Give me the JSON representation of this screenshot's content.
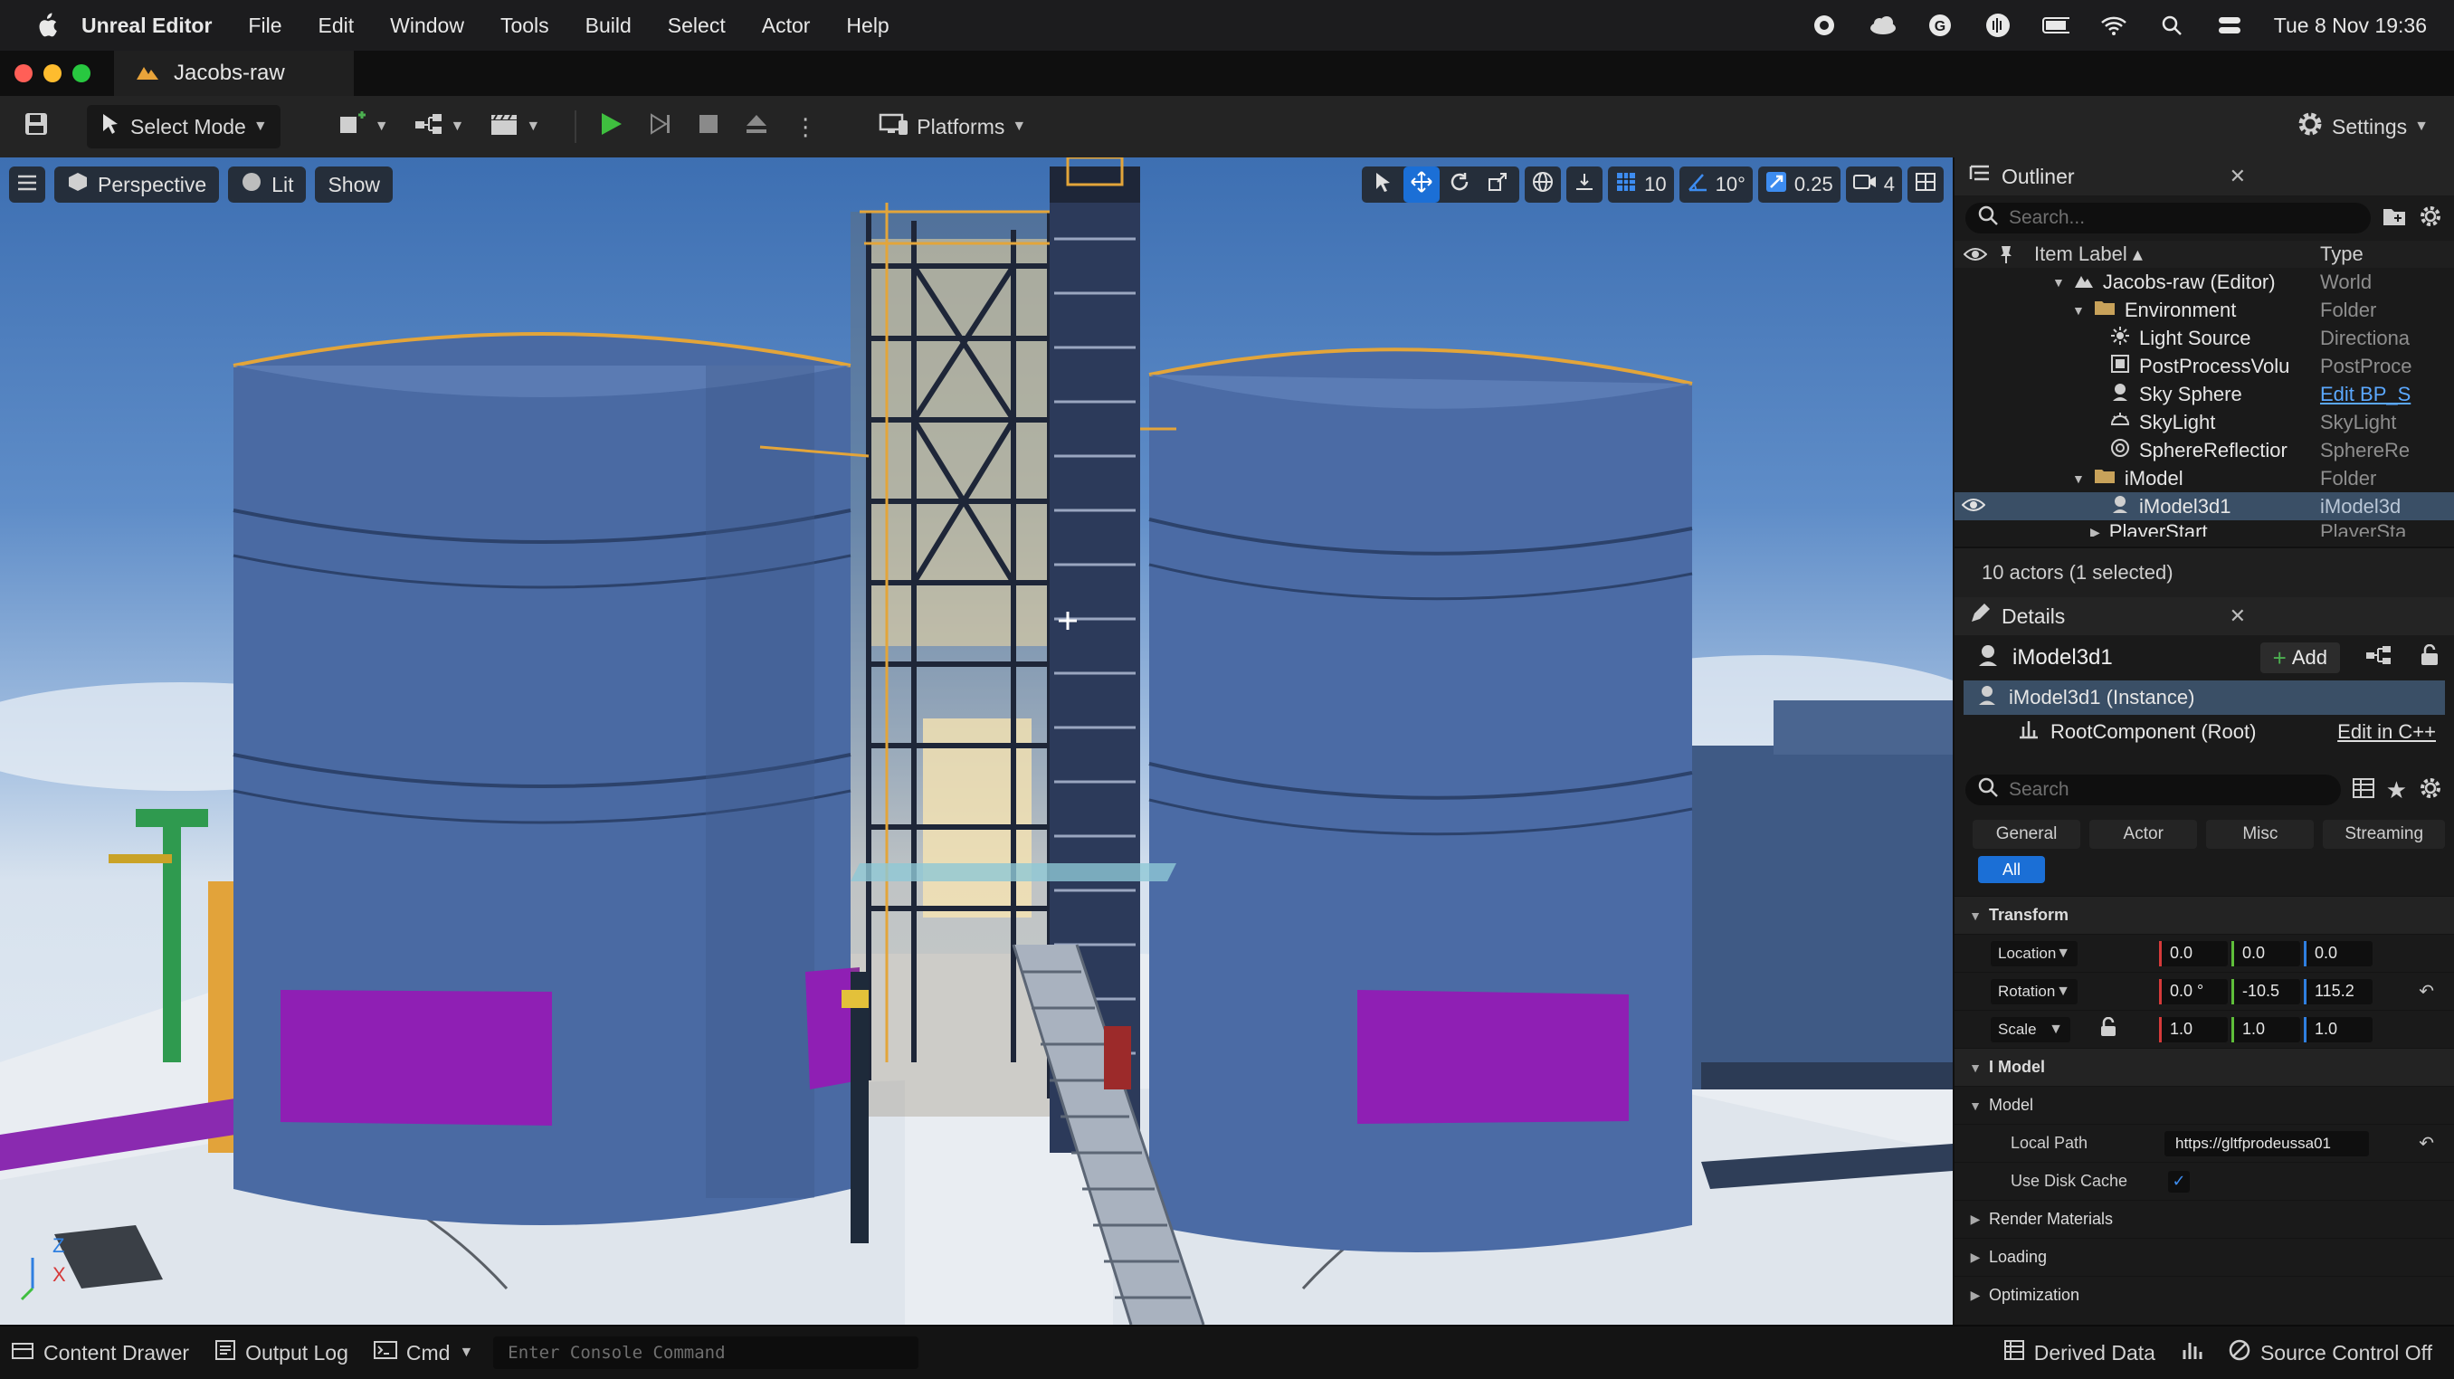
{
  "menubar": {
    "app_name": "Unreal Editor",
    "menus": [
      "File",
      "Edit",
      "Window",
      "Tools",
      "Build",
      "Select",
      "Actor",
      "Help"
    ],
    "clock": "Tue 8 Nov  19:36"
  },
  "window": {
    "tab_title": "Jacobs-raw"
  },
  "toolbar": {
    "select_mode": "Select Mode",
    "platforms": "Platforms",
    "settings": "Settings"
  },
  "viewport": {
    "perspective": "Perspective",
    "lit": "Lit",
    "show": "Show",
    "grid_snap": "10",
    "rotation_snap": "10°",
    "scale_snap": "0.25",
    "camera_speed": "4",
    "axis_z": "Z",
    "axis_x": "X"
  },
  "outliner": {
    "title": "Outliner",
    "search_placeholder": "Search...",
    "col_label": "Item Label ▴",
    "col_type": "Type",
    "rows": [
      {
        "label": "Jacobs-raw (Editor)",
        "type": "World"
      },
      {
        "label": "Environment",
        "type": "Folder"
      },
      {
        "label": "Light Source",
        "type": "Directiona"
      },
      {
        "label": "PostProcessVolu",
        "type": "PostProce"
      },
      {
        "label": "Sky Sphere",
        "type": "Edit BP_S"
      },
      {
        "label": "SkyLight",
        "type": "SkyLight"
      },
      {
        "label": "SphereReflectior",
        "type": "SphereRe"
      },
      {
        "label": "iModel",
        "type": "Folder"
      },
      {
        "label": "iModel3d1",
        "type": "iModel3d"
      },
      {
        "label": "PlayerStart",
        "type": "PlayerSta"
      }
    ],
    "footer": "10 actors (1 selected)"
  },
  "details": {
    "title": "Details",
    "actor_name": "iModel3d1",
    "add_label": "Add",
    "instance": "iModel3d1 (Instance)",
    "root_component": "RootComponent (Root)",
    "edit_cpp": "Edit in C++",
    "search_placeholder": "Search",
    "filters": [
      "General",
      "Actor",
      "Misc",
      "Streaming"
    ],
    "filter_all": "All",
    "transform": {
      "section": "Transform",
      "location_label": "Location",
      "location": [
        "0.0",
        "0.0",
        "0.0"
      ],
      "rotation_label": "Rotation",
      "rotation": [
        "0.0 °",
        "-10.5",
        "115.2"
      ],
      "scale_label": "Scale",
      "scale": [
        "1.0",
        "1.0",
        "1.0"
      ]
    },
    "imodel_section": "I Model",
    "model_section": "Model",
    "local_path_label": "Local Path",
    "local_path_value": "https://gltfprodeussa01",
    "disk_cache_label": "Use Disk Cache",
    "render_materials": "Render Materials",
    "loading": "Loading",
    "optimization": "Optimization"
  },
  "statusbar": {
    "content_drawer": "Content Drawer",
    "output_log": "Output Log",
    "cmd": "Cmd",
    "console_placeholder": "Enter Console Command",
    "derived_data": "Derived Data",
    "source_control": "Source Control Off"
  },
  "colors": {
    "accent_blue": "#1b6fd6",
    "selection": "#3a4f66",
    "play_green": "#3fbf3f"
  }
}
